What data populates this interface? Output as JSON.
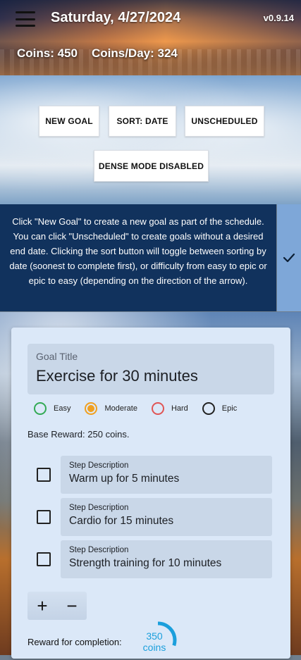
{
  "header": {
    "date": "Saturday, 4/27/2024",
    "version": "v0.9.14",
    "coins_text": "Coins: 450",
    "coins_per_day_text": "Coins/Day: 324"
  },
  "toolbar": {
    "new_goal": "NEW GOAL",
    "sort": "SORT: DATE",
    "unscheduled": "UNSCHEDULED",
    "dense_mode": "DENSE MODE DISABLED"
  },
  "info_banner": {
    "text": "Click \"New Goal\" to create a new goal as part of the schedule. You can click \"Unscheduled\" to create goals without a desired end date. Clicking the sort button will toggle between sorting by date (soonest to complete first), or difficulty from easy to epic or epic to easy (depending on the direction of the arrow)."
  },
  "goal": {
    "title_label": "Goal Title",
    "title_value": "Exercise for 30 minutes",
    "difficulty_options": [
      {
        "label": "Easy",
        "color": "#33aa55",
        "selected": false
      },
      {
        "label": "Moderate",
        "color": "#f0a020",
        "selected": true
      },
      {
        "label": "Hard",
        "color": "#e05555",
        "selected": false
      },
      {
        "label": "Epic",
        "color": "#222222",
        "selected": false
      }
    ],
    "base_reward": "Base Reward: 250 coins.",
    "steps": [
      {
        "label": "Step Description",
        "value": "Warm up for 5 minutes"
      },
      {
        "label": "Step Description",
        "value": "Cardio for 15 minutes"
      },
      {
        "label": "Step Description",
        "value": "Strength training for 10 minutes"
      }
    ],
    "add_step": "+",
    "remove_step": "−",
    "reward_label": "Reward for completion:",
    "reward_amount": "350",
    "reward_unit": "coins",
    "reward_ring_fraction": 0.3
  },
  "colors": {
    "banner_bg": "#0c2e5b",
    "card_bg": "#dbe8f8",
    "reward_accent": "#1b9fdc"
  }
}
